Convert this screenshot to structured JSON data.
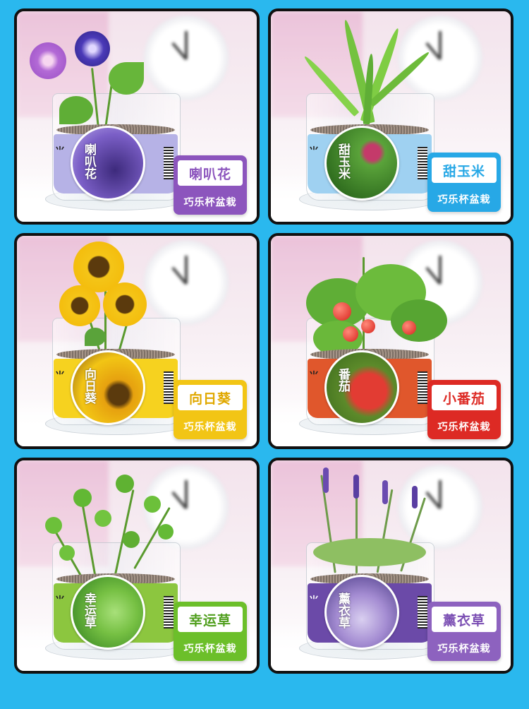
{
  "cards": [
    {
      "name": "喇叭花",
      "badge": "喇叭花",
      "subtitle": "巧乐杯盆栽",
      "plaque_color": "#8c55bd",
      "band_color": "#b6b2e6",
      "badge_colors": [
        "#7b5fc7",
        "#3d2a7c"
      ],
      "plant": "morning-glory-icon"
    },
    {
      "name": "甜玉米",
      "badge": "甜玉米",
      "subtitle": "巧乐杯盆栽",
      "plaque_color": "#27a8e6",
      "band_color": "#9fd1f1",
      "badge_colors": [
        "#5aa33a",
        "#2d6a1d"
      ],
      "plant": "corn-icon"
    },
    {
      "name": "向日葵",
      "badge": "向日葵",
      "subtitle": "巧乐杯盆栽",
      "plaque_color": "#f2c515",
      "band_color": "#f6d21f",
      "badge_colors": [
        "#e6a10f",
        "#5b3a0d"
      ],
      "plant": "sunflower-icon"
    },
    {
      "name": "小番茄",
      "badge": "番茄",
      "subtitle": "巧乐杯盆栽",
      "plaque_color": "#dd2a24",
      "band_color": "#e0572c",
      "badge_colors": [
        "#e23c33",
        "#5c8a2a"
      ],
      "plant": "tomato-icon"
    },
    {
      "name": "幸运草",
      "badge": "幸运草",
      "subtitle": "巧乐杯盆栽",
      "plaque_color": "#6cbf2a",
      "band_color": "#8cc63f",
      "badge_colors": [
        "#76c043",
        "#2e7d1e"
      ],
      "plant": "clover-icon"
    },
    {
      "name": "薰衣草",
      "badge": "薰衣草",
      "subtitle": "巧乐杯盆栽",
      "plaque_color": "#8d62bf",
      "band_color": "#6b4aa8",
      "badge_colors": [
        "#a48cd2",
        "#4a3a86"
      ],
      "plant": "lavender-icon"
    }
  ]
}
